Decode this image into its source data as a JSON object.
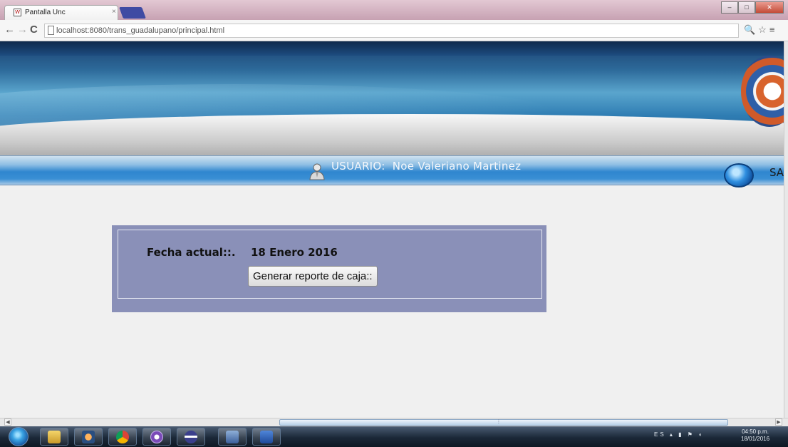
{
  "browser": {
    "tab_title": "Pantalla Unc",
    "tab_close": "×",
    "url": "localhost:8080/trans_guadalupano/principal.html"
  },
  "header": {
    "user_prefix": "USUARIO:",
    "user_name": "Noe Valeriano Martinez",
    "logout_label": "SA"
  },
  "form": {
    "date_label": "Fecha actual::.",
    "date_value": "18 Enero 2016",
    "report_button": "Generar reporte de caja::"
  },
  "taskbar": {
    "language": "ES",
    "time": "04:50 p.m.",
    "date": "18/01/2016"
  }
}
